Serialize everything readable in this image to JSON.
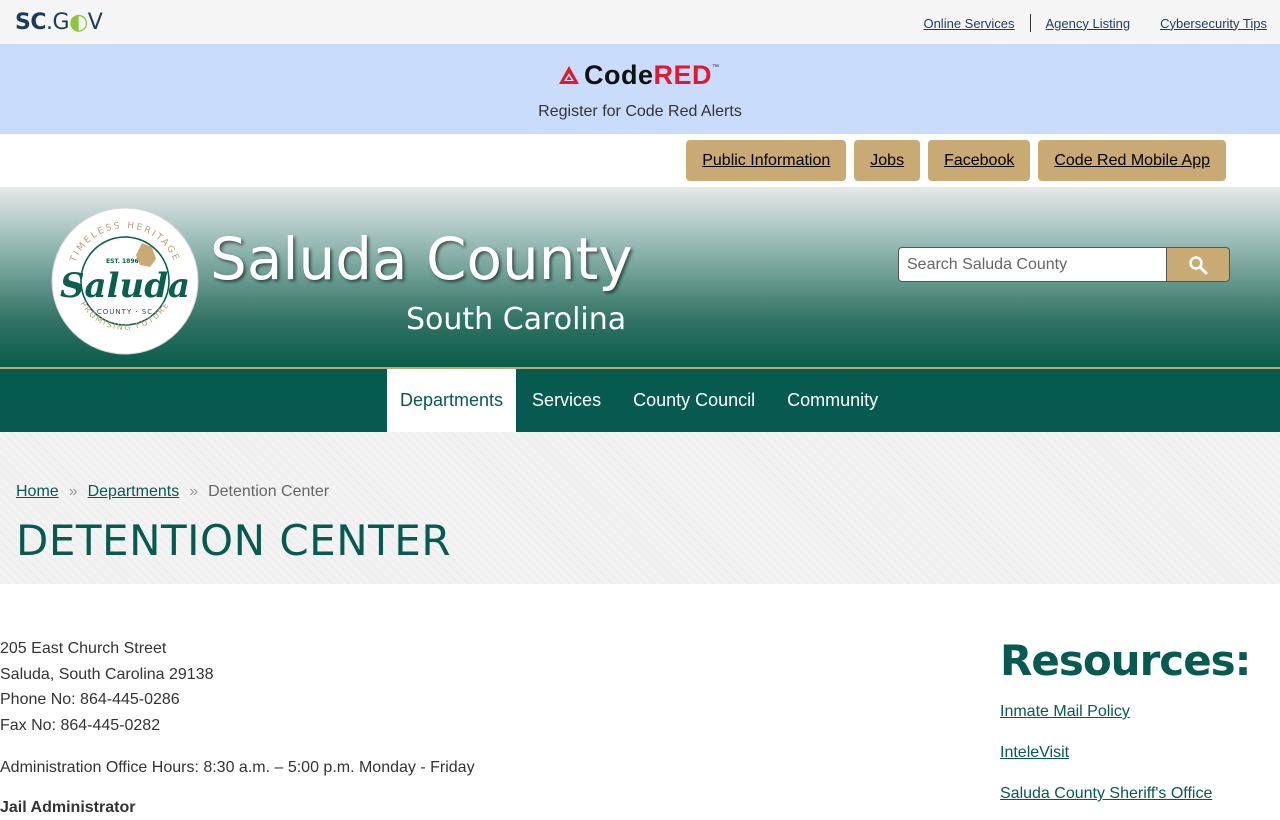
{
  "topbar": {
    "logo": {
      "sc": "SC",
      "dot": ".",
      "g": "G",
      "o": "◐",
      "v": "V"
    },
    "links": [
      "Online Services",
      "Agency Listing",
      "Cybersecurity Tips"
    ]
  },
  "codered": {
    "logo_code": "Code",
    "logo_red": "RED",
    "logo_tm": "™",
    "text": "Register for Code Red Alerts"
  },
  "quick_links": [
    "Public Information",
    "Jobs",
    "Facebook",
    "Code Red Mobile App"
  ],
  "header": {
    "title": "Saluda County",
    "subtitle": "South Carolina",
    "seal": {
      "top_text": "TIMELESS HERITAGE",
      "est": "EST. 1896",
      "name": "Saluda",
      "county": "COUNTY · SC",
      "bottom_text": "PROMISING FUTURE"
    },
    "search_placeholder": "Search Saluda County"
  },
  "nav": {
    "items": [
      "Departments",
      "Services",
      "County Council",
      "Community"
    ],
    "active": "Departments"
  },
  "breadcrumb": {
    "home": "Home",
    "departments": "Departments",
    "current": "Detention Center",
    "sep": "»"
  },
  "page_title": "DETENTION CENTER",
  "contact": {
    "street": "205 East Church Street",
    "city": "Saluda, South Carolina  29138",
    "phone": "Phone No: 864-445-0286",
    "fax": "Fax No: 864-445-0282",
    "hours": "Administration Office Hours: 8:30 a.m. – 5:00 p.m. Monday - Friday",
    "next_heading": "Jail Administrator"
  },
  "resources": {
    "heading": "Resources:",
    "links": [
      "Inmate Mail Policy",
      "InteleVisit",
      "Saluda County Sheriff's Office"
    ]
  },
  "colors": {
    "brand_green": "#075a4f",
    "tan": "#c9a974",
    "codered_bg": "#c9dcfb",
    "codered_red": "#e2182e"
  }
}
